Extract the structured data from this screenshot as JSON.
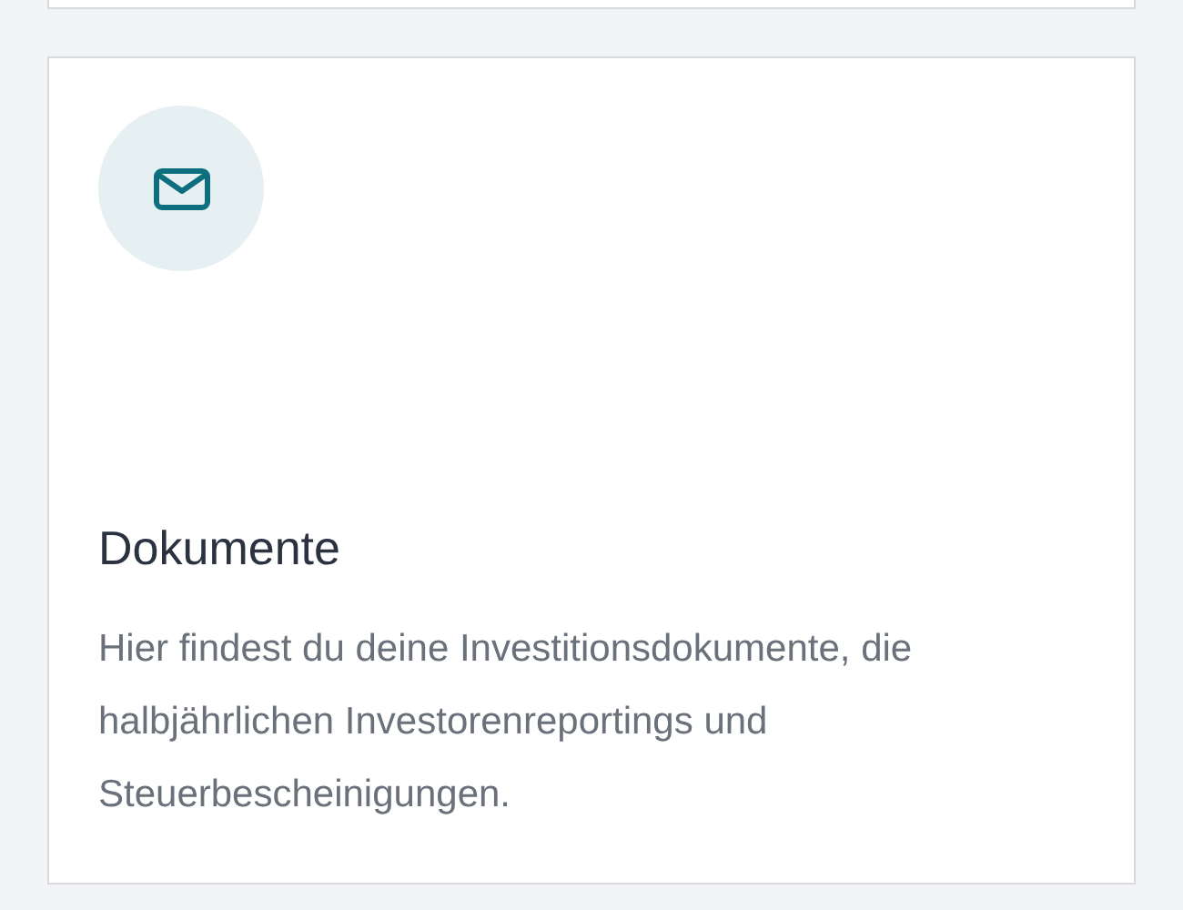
{
  "cards": [
    {
      "kind": "partial"
    },
    {
      "kind": "info",
      "title": "Dokumente",
      "description": "Hier findest du deine Investitionsdokumente, die halbjährlichen Investorenreportings und Steuerbescheinigungen."
    }
  ]
}
